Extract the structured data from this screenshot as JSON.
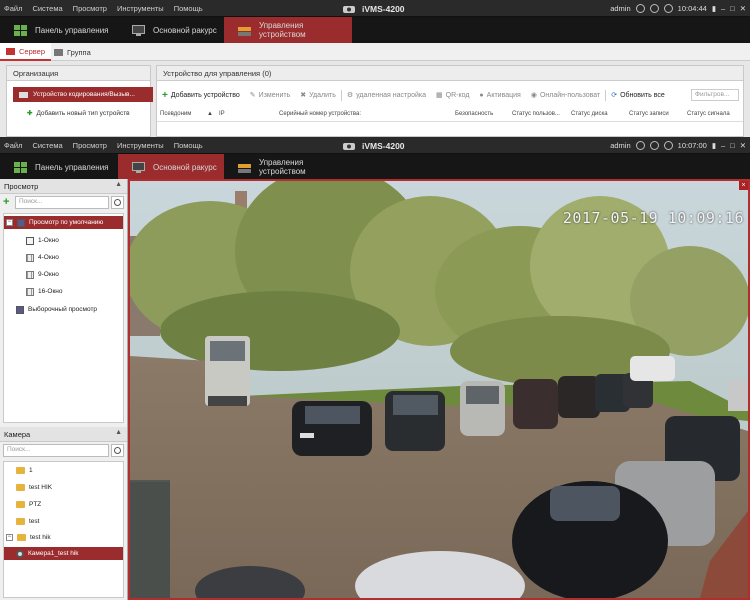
{
  "app": {
    "title": "iVMS-4200",
    "menu": [
      "Файл",
      "Система",
      "Просмотр",
      "Инструменты",
      "Помощь"
    ],
    "user": "admin",
    "tabs": [
      "Панель управления",
      "Основной ракурс",
      "Управления устройством"
    ]
  },
  "back_window": {
    "time": "10:04:44",
    "active_tab": 2,
    "subtabs": [
      "Сервер",
      "Группа"
    ],
    "org_panel": {
      "header": "Организация",
      "selected_item": "Устройство кодирования/Вызыв...",
      "add_item": "Добавить новый тип устройств"
    },
    "device_panel": {
      "header": "Устройство для управления (0)",
      "toolbar": [
        "Добавить устройство",
        "Изменить",
        "Удалить",
        "удаленная настройка",
        "QR-код",
        "Активация",
        "Онлайн-пользоват",
        "Обновить все"
      ],
      "filter_placeholder": "Фильтров...",
      "columns": [
        "Псевдоним",
        "IP",
        "Серийный номер устройства:",
        "Безопасность",
        "Статус пользов...",
        "Статус диска",
        "Статус записи",
        "Статус сигнала"
      ]
    }
  },
  "front_window": {
    "time": "10:07:00",
    "active_tab": 1,
    "view_section": {
      "header": "Просмотр",
      "search_placeholder": "Поиск...",
      "default_view": "Просмотр по умолчанию",
      "layouts": [
        "1-Окно",
        "4-Окно",
        "9-Окно",
        "16-Окно"
      ],
      "custom_view": "Выборочный просмотр"
    },
    "camera_section": {
      "header": "Камера",
      "search_placeholder": "Поиск...",
      "folders": [
        "1",
        "test HIK",
        "PTZ",
        "test"
      ],
      "expanded_folder": "test hik",
      "selected_camera": "Камера1_test hik"
    },
    "video": {
      "timestamp": "2017-05-19 10:09:16",
      "close_glyph": "×"
    }
  },
  "colors": {
    "accent": "#9b2c2e",
    "bar": "#2a2a2a"
  }
}
